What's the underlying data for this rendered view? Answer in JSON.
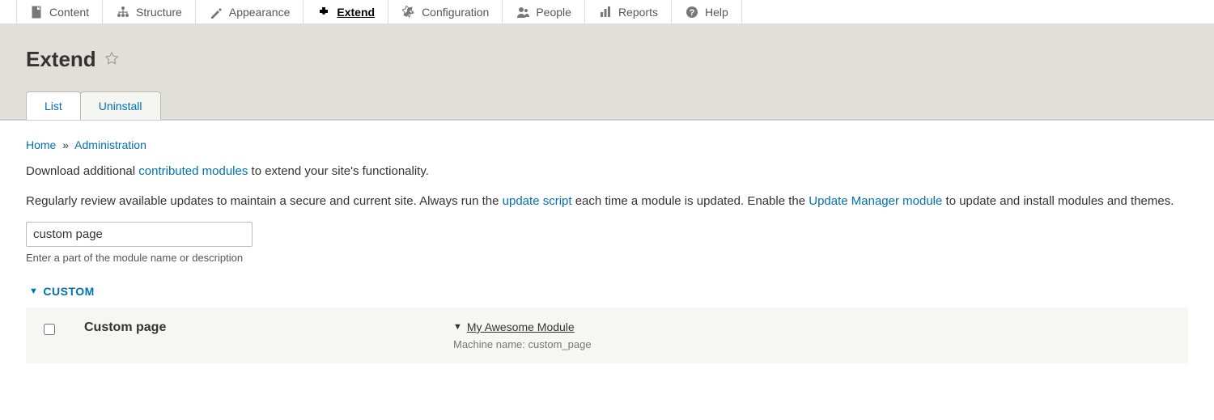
{
  "toolbar": {
    "items": [
      {
        "label": "Content",
        "name": "content"
      },
      {
        "label": "Structure",
        "name": "structure"
      },
      {
        "label": "Appearance",
        "name": "appearance"
      },
      {
        "label": "Extend",
        "name": "extend",
        "active": true
      },
      {
        "label": "Configuration",
        "name": "configuration"
      },
      {
        "label": "People",
        "name": "people"
      },
      {
        "label": "Reports",
        "name": "reports"
      },
      {
        "label": "Help",
        "name": "help"
      }
    ]
  },
  "header": {
    "title": "Extend"
  },
  "tabs": {
    "list": "List",
    "uninstall": "Uninstall"
  },
  "breadcrumb": {
    "home": "Home",
    "sep": "»",
    "admin": "Administration"
  },
  "intro1": {
    "a": "Download additional ",
    "link": "contributed modules",
    "b": " to extend your site's functionality."
  },
  "intro2": {
    "a": "Regularly review available updates to maintain a secure and current site. Always run the ",
    "link1": "update script",
    "b": " each time a module is updated. Enable the ",
    "link2": "Update Manager module",
    "c": " to update and install modules and themes."
  },
  "filter": {
    "value": "custom page",
    "desc": "Enter a part of the module name or description"
  },
  "package": {
    "name": "CUSTOM"
  },
  "module": {
    "name": "Custom page",
    "desc": "My Awesome Module",
    "machine_label": "Machine name:",
    "machine_name": "custom_page"
  }
}
